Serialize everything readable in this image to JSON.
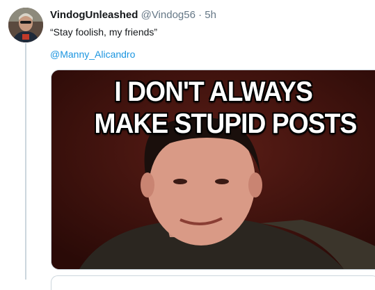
{
  "tweet": {
    "display_name": "VindogUnleashed",
    "handle": "@Vindog56",
    "separator": "·",
    "time": "5h",
    "text": "“Stay foolish, my friends”",
    "mention": "@Manny_Alicandro"
  },
  "media": {
    "meme_line1": "I DON'T ALWAYS",
    "meme_line2": "MAKE STUPID POSTS"
  },
  "colors": {
    "link": "#1b95e0",
    "meta": "#657786",
    "thread_line": "#ccd6dd"
  }
}
